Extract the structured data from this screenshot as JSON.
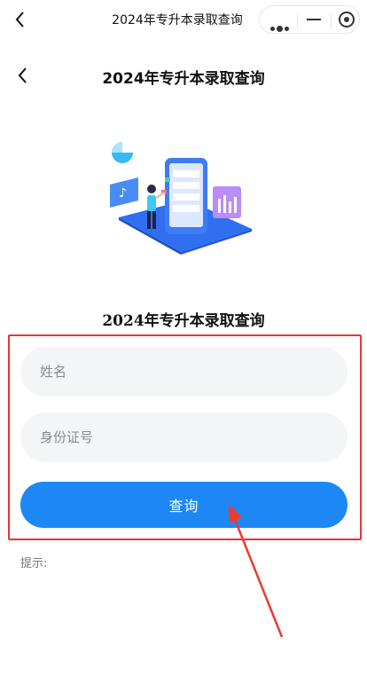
{
  "window": {
    "title": "2024年专升本录取查询",
    "back_icon": "chevron-left-icon",
    "menu_icon": "more-dots-icon",
    "minimize_icon": "minus-icon",
    "close_icon": "target-circle-icon"
  },
  "page": {
    "title": "2024年专升本录取查询",
    "back_icon": "chevron-left-icon"
  },
  "form": {
    "title": "2024年专升本录取查询",
    "name_placeholder": "姓名",
    "name_value": "",
    "id_placeholder": "身份证号",
    "id_value": "",
    "submit_label": "查询",
    "hint_label": "提示:"
  },
  "colors": {
    "accent": "#1d88f5",
    "field_bg": "#f4f5f7",
    "highlight_frame": "#e53535"
  }
}
